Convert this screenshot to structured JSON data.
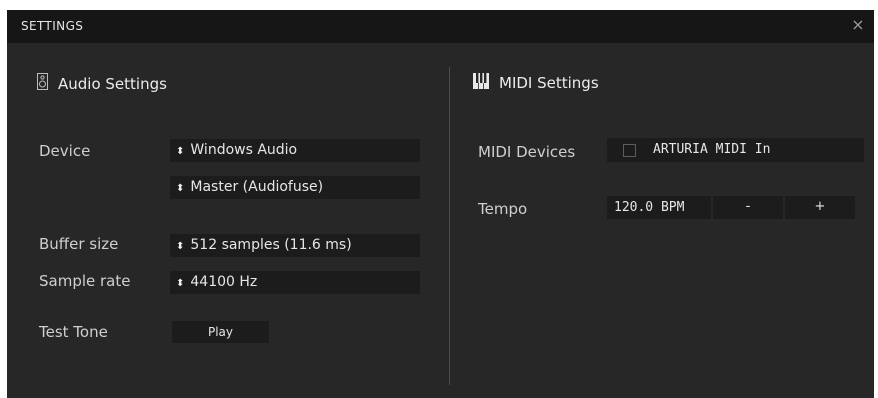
{
  "window": {
    "title": "SETTINGS",
    "close_glyph": "×"
  },
  "audio": {
    "header": "Audio Settings",
    "icon": "speaker-icon",
    "device_label": "Device",
    "device_value": "Windows Audio",
    "output_value": "Master (Audiofuse)",
    "buffer_label": "Buffer size",
    "buffer_value": "512 samples (11.6 ms)",
    "rate_label": "Sample rate",
    "rate_value": "44100 Hz",
    "test_label": "Test Tone",
    "play_label": "Play"
  },
  "midi": {
    "header": "MIDI Settings",
    "icon": "piano-keys-icon",
    "devices_label": "MIDI Devices",
    "device_name": "ARTURIA MIDI In",
    "device_checked": false,
    "tempo_label": "Tempo",
    "tempo_value": "120.0 BPM",
    "minus_label": "-",
    "plus_label": "+"
  },
  "select_arrow": "⬍"
}
